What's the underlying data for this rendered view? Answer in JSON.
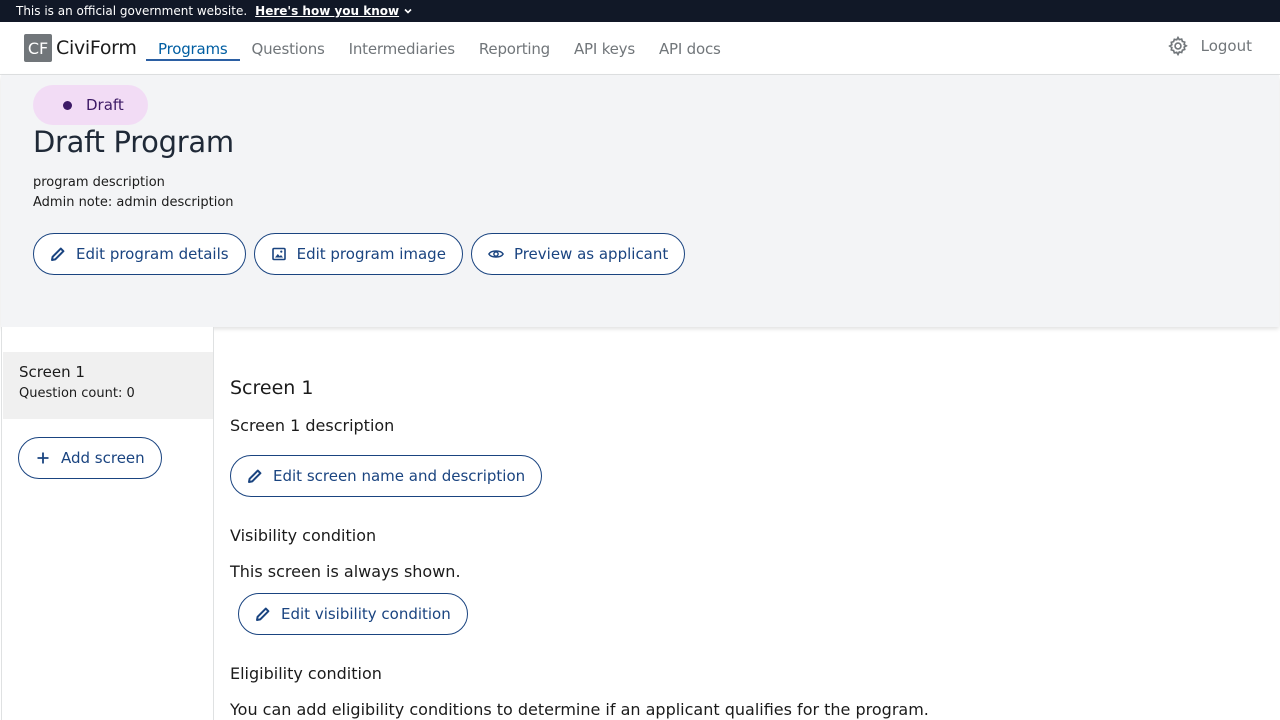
{
  "gov_banner": {
    "text": "This is an official government website.",
    "link": "Here's how you know"
  },
  "header": {
    "logo_mark": "CF",
    "app_name": "CiviForm",
    "nav": [
      {
        "label": "Programs",
        "active": true
      },
      {
        "label": "Questions",
        "active": false
      },
      {
        "label": "Intermediaries",
        "active": false
      },
      {
        "label": "Reporting",
        "active": false
      },
      {
        "label": "API keys",
        "active": false
      },
      {
        "label": "API docs",
        "active": false
      }
    ],
    "settings_icon": "gear-icon",
    "logout": "Logout"
  },
  "program": {
    "status": "Draft",
    "title": "Draft Program",
    "description": "program description",
    "admin_note": "Admin note: admin description",
    "buttons": {
      "edit_details": "Edit program details",
      "edit_image": "Edit program image",
      "preview": "Preview as applicant"
    }
  },
  "sidebar": {
    "screens": [
      {
        "name": "Screen 1",
        "count": "Question count: 0"
      }
    ],
    "add_screen": "Add screen"
  },
  "main": {
    "screen_title": "Screen 1",
    "screen_description": "Screen 1 description",
    "edit_screen": "Edit screen name and description",
    "visibility_heading": "Visibility condition",
    "visibility_text": "This screen is always shown.",
    "edit_visibility": "Edit visibility condition",
    "eligibility_heading": "Eligibility condition",
    "eligibility_text": "You can add eligibility conditions to determine if an applicant qualifies for the program."
  },
  "colors": {
    "primary": "#1a4480",
    "banner_bg": "#111827",
    "draft_pill_bg": "#f2dcf5",
    "draft_pill_text": "#3d1a66",
    "header_bg": "#f3f4f6"
  }
}
